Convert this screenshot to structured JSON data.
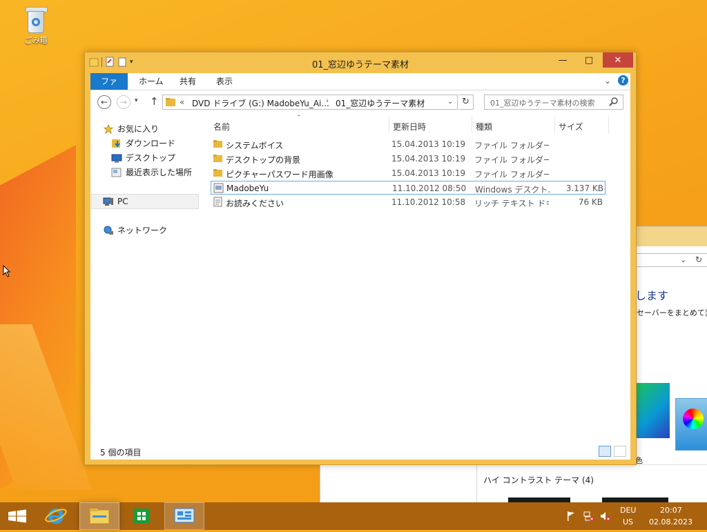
{
  "desktop": {
    "recycle_bin_label": "ごみ箱",
    "accent_color": "#f7a51c"
  },
  "background_window": {
    "heading": "します",
    "subtext": "セーバーをまとめて変更",
    "theme_label": "色",
    "high_contrast_label": "ハイ コントラスト テーマ (4)"
  },
  "explorer": {
    "title": "01_窓辺ゆうテーマ素材",
    "ribbon": {
      "tabs": [
        "ファイル",
        "ホーム",
        "共有",
        "表示"
      ],
      "help": "?"
    },
    "address": {
      "overflow": "«",
      "crumb1": "DVD ドライブ (G:) MadobeYu_Ai...",
      "separator": "›",
      "crumb2": "01_窓辺ゆうテーマ素材"
    },
    "search_placeholder": "01_窓辺ゆうテーマ素材の検索",
    "nav": {
      "favorites": "お気に入り",
      "downloads": "ダウンロード",
      "desktop": "デスクトップ",
      "recent": "最近表示した場所",
      "pc": "PC",
      "network": "ネットワーク"
    },
    "columns": {
      "name": "名前",
      "date": "更新日時",
      "type": "種類",
      "size": "サイズ"
    },
    "files": [
      {
        "name": "システムボイス",
        "date": "15.04.2013 10:19",
        "type": "ファイル フォルダー",
        "size": "",
        "icon": "folder-icon"
      },
      {
        "name": "デスクトップの背景",
        "date": "15.04.2013 10:19",
        "type": "ファイル フォルダー",
        "size": "",
        "icon": "folder-icon"
      },
      {
        "name": "ピクチャーパスワード用画像",
        "date": "15.04.2013 10:19",
        "type": "ファイル フォルダー",
        "size": "",
        "icon": "folder-icon"
      },
      {
        "name": "MadobeYu",
        "date": "11.10.2012 08:50",
        "type": "Windows デスクト...",
        "size": "3.137 KB",
        "icon": "theme-file-icon"
      },
      {
        "name": "お読みください",
        "date": "11.10.2012 10:58",
        "type": "リッチ テキスト ドキュ...",
        "size": "76 KB",
        "icon": "document-icon"
      }
    ],
    "status": "5 個の項目"
  },
  "taskbar": {
    "lang_top": "DEU",
    "lang_bottom": "US",
    "time": "20:07",
    "date": "02.08.2023",
    "color": "#a9630f"
  }
}
